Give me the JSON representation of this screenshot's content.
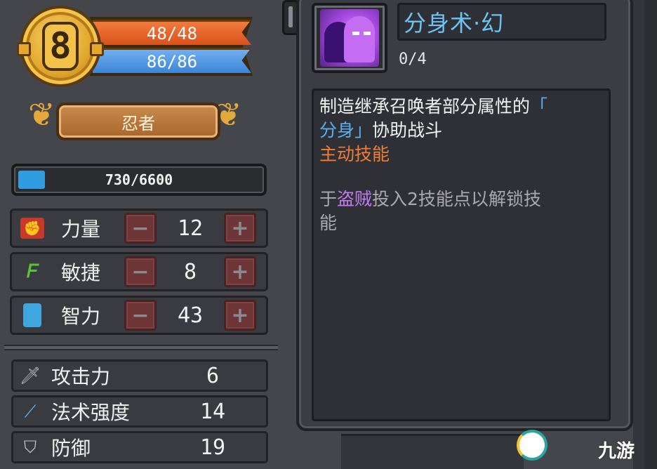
{
  "player": {
    "level": "8",
    "hp": "48/48",
    "mp": "86/86",
    "class_name": "忍者",
    "xp_text": "730/6600",
    "xp_fraction": 0.11
  },
  "stats": [
    {
      "label": "力量",
      "value": "12",
      "icon": "fist-icon",
      "color": "#d8412c"
    },
    {
      "label": "敏捷",
      "value": "8",
      "icon": "wing-icon",
      "color": "#5bc23a"
    },
    {
      "label": "智力",
      "value": "43",
      "icon": "book-icon",
      "color": "#3fa6e0"
    }
  ],
  "attributes": [
    {
      "label": "攻击力",
      "value": "6",
      "icon": "sword-icon"
    },
    {
      "label": "法术强度",
      "value": "14",
      "icon": "wand-icon"
    },
    {
      "label": "防御",
      "value": "19",
      "icon": "shield-icon"
    }
  ],
  "skill": {
    "name": "分身术·幻",
    "level": "0/4",
    "desc_line1": "制造继承召唤者部分属性的",
    "desc_quote_open": "「",
    "desc_clone": "分身",
    "desc_quote_close": "」",
    "desc_line2_rest": "协助战斗",
    "type": "主动技能",
    "unlock_prefix": "于",
    "unlock_class": "盗贼",
    "unlock_rest": "投入2技能点以解锁技",
    "unlock_tail": "能"
  },
  "watermark": {
    "text": "九游",
    "brand_color": "#2aa5a0"
  }
}
